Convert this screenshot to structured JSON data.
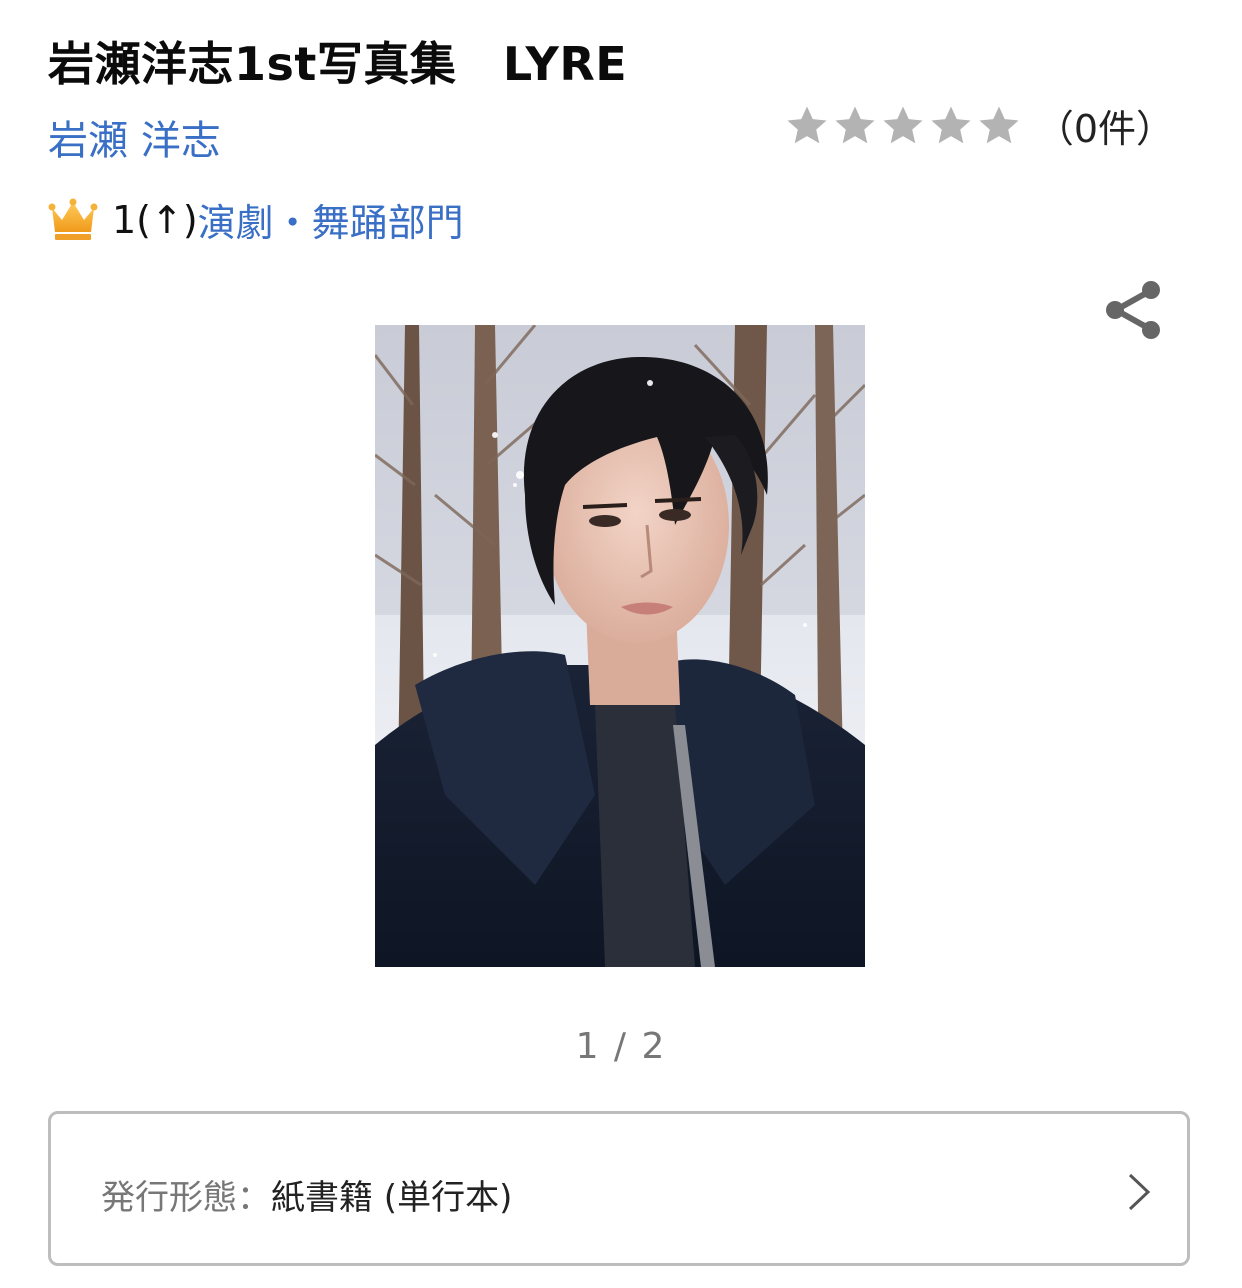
{
  "product": {
    "title": "岩瀬洋志1st写真集　LYRE",
    "author": "岩瀬 洋志",
    "rating": {
      "value": 0,
      "max": 5,
      "count_text": "（0件）"
    },
    "ranking": {
      "rank_text": "1(↑)",
      "category_label": "演劇・舞踊部門"
    },
    "gallery": {
      "pager_text": "1 / 2",
      "current": 1,
      "total": 2
    },
    "format": {
      "label": "発行形態：",
      "value": "紙書籍 (単行本)"
    }
  },
  "icons": {
    "crown": "crown-icon",
    "share": "share-icon",
    "star": "star-icon",
    "chevron": "chevron-right-icon"
  },
  "colors": {
    "link": "#3a6fc6",
    "star_empty": "#b3b3b3",
    "crown": "#f5a623",
    "share": "#666666",
    "border": "#bdbdbd"
  }
}
